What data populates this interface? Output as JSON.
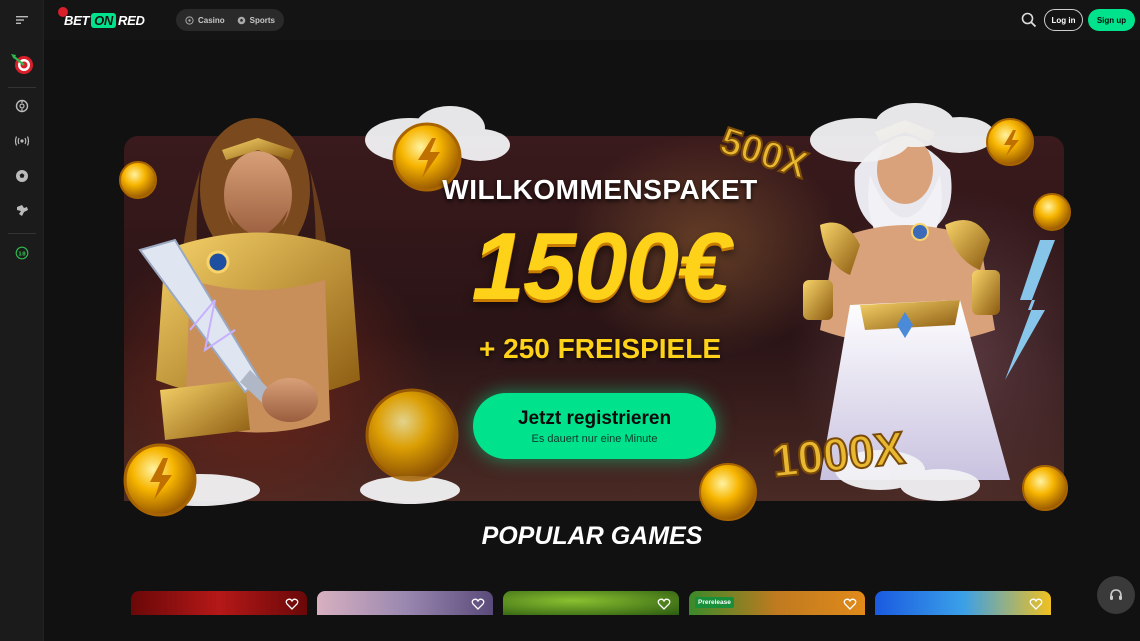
{
  "header": {
    "logo_text_pre": "BET",
    "logo_text_on": "ON",
    "logo_text_post": "RED",
    "tabs": [
      {
        "label": "Casino",
        "icon": "casino-chip-icon"
      },
      {
        "label": "Sports",
        "icon": "soccer-ball-icon"
      }
    ],
    "login_label": "Log in",
    "signup_label": "Sign up"
  },
  "sidebar": {
    "items": [
      {
        "icon": "menu-icon"
      },
      {
        "icon": "dart-target-icon"
      },
      {
        "icon": "casino-chip-icon"
      },
      {
        "icon": "live-broadcast-icon"
      },
      {
        "icon": "soccer-ball-icon"
      },
      {
        "icon": "soccer-kick-icon"
      },
      {
        "icon": "eighteen-plus-icon"
      }
    ]
  },
  "banner": {
    "title": "WILLKOMMENSPAKET",
    "amount": "1500€",
    "free_spins": "+ 250 FREISPIELE",
    "cta_label": "Jetzt registrieren",
    "cta_sub": "Es dauert nur eine Minute",
    "multiplier_top": "500X",
    "multiplier_bottom": "1000X"
  },
  "popular": {
    "title": "POPULAR GAMES",
    "games": [
      {
        "badge": "",
        "colors": [
          "#7a0a0a",
          "#b51818"
        ]
      },
      {
        "badge": "",
        "colors": [
          "#c9a8b8",
          "#6a5a8a"
        ]
      },
      {
        "badge": "",
        "colors": [
          "#5a8a1a",
          "#2a5a10"
        ]
      },
      {
        "badge": "Prerelease",
        "colors": [
          "#3a8a2a",
          "#e08a1a"
        ]
      },
      {
        "badge": "",
        "colors": [
          "#1a6ae0",
          "#f0c020"
        ]
      }
    ]
  },
  "colors": {
    "accent": "#00e28c",
    "brand_red": "#d81f2a",
    "gold": "#ffd21a"
  }
}
